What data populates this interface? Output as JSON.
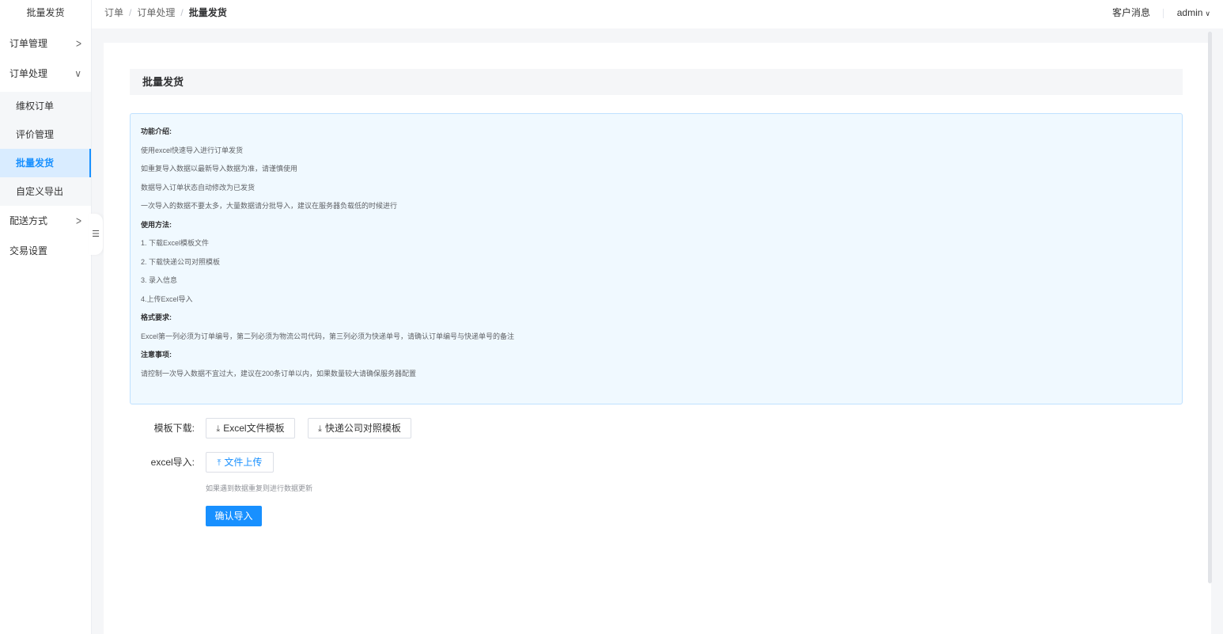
{
  "sidebar": {
    "title": "批量发货",
    "menu": [
      {
        "label": "订单管理",
        "arrow": ">"
      },
      {
        "label": "订单处理",
        "arrow": "∨"
      },
      {
        "label": "配送方式",
        "arrow": ">"
      },
      {
        "label": "交易设置"
      }
    ],
    "submenu": [
      {
        "label": "维权订单"
      },
      {
        "label": "评价管理"
      },
      {
        "label": "批量发货"
      },
      {
        "label": "自定义导出"
      }
    ],
    "collapse_icon": "☰"
  },
  "header": {
    "breadcrumb": [
      "订单",
      "订单处理",
      "批量发货"
    ],
    "breadcrumb_sep": "/",
    "messages": "客户消息",
    "user": "admin",
    "user_chevron": "∨"
  },
  "main": {
    "section_title": "批量发货",
    "info_lines": [
      "功能介绍:",
      "使用excel快速导入进行订单发货",
      "如重复导入数据以最新导入数据为准，请谨慎使用",
      "数据导入订单状态自动修改为已发货",
      "一次导入的数据不要太多，大量数据请分批导入，建议在服务器负载低的时候进行",
      "使用方法:",
      "1. 下载Excel模板文件",
      "2. 下载快递公司对照模板",
      "3. 录入信息",
      "4.上传Excel导入",
      "格式要求:",
      "Excel第一列必须为订单编号，第二列必须为物流公司代码，第三列必须为快递单号，请确认订单编号与快递单号的备注",
      "注意事项:",
      "请控制一次导入数据不宜过大，建议在200条订单以内，如果数量较大请确保服务器配置"
    ],
    "template_label": "模板下载:",
    "excel_template_btn": "Excel文件模板",
    "courier_template_btn": "快递公司对照模板",
    "import_label": "excel导入:",
    "upload_btn": "文件上传",
    "hint": "如果遇到数据重复则进行数据更新",
    "confirm_btn": "确认导入",
    "icons": {
      "download": "⤓",
      "upload": "⤒"
    }
  },
  "colors": {
    "primary": "#1890ff",
    "info_bg": "#f0f9ff",
    "info_border": "#bfe1ff",
    "active_bg": "#d9ecff"
  }
}
